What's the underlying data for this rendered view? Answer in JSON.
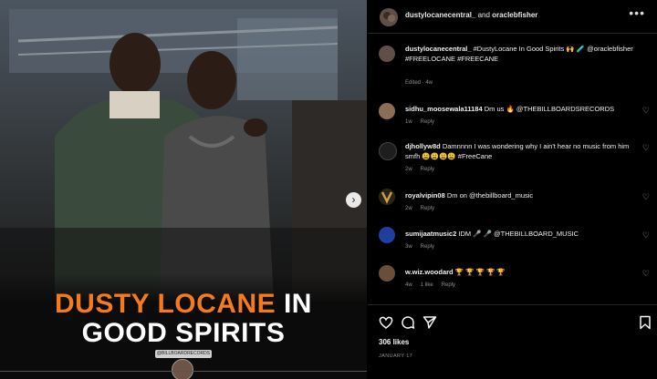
{
  "post": {
    "headline_line1_orange": "DUSTY LOCANE",
    "headline_line1_white": " IN",
    "headline_line2": "GOOD SPIRITS",
    "credit_text": "@BILLBOARDRECORDS"
  },
  "header": {
    "user1": "dustylocanecentral_",
    "connector": " and ",
    "user2": "oraclebfisher",
    "more": "•••"
  },
  "caption": {
    "username": "dustylocanecentral_",
    "text": " #DustyLocane In Good Spirits 🙌 🧪 @oraclebfisher #FREELOCANE #FREECANE",
    "meta": "Edited · 4w"
  },
  "comments": [
    {
      "username": "sidhu_moosewala11184",
      "text": " Dm us 🔥 @THEBILLBOARDSRECORDS",
      "age": "1w",
      "reply": "Reply",
      "likes": ""
    },
    {
      "username": "djhollyw8d",
      "text": " Damnnnn I was wondering why I ain't hear no music from him smfh 😩😩😩😩 #FreeCane",
      "age": "2w",
      "reply": "Reply",
      "likes": ""
    },
    {
      "username": "royalvipin08",
      "text": " Dm on @thebillboard_music",
      "age": "2w",
      "reply": "Reply",
      "likes": ""
    },
    {
      "username": "sumijaatmusic2",
      "text": " IDM 🎤 🎤 @THEBILLBOARD_MUSIC",
      "age": "3w",
      "reply": "Reply",
      "likes": ""
    },
    {
      "username": "w.wiz.woodard",
      "text": " 🏆 🏆 🏆 🏆 🏆",
      "age": "4w",
      "reply": "Reply",
      "likes": "1 like"
    }
  ],
  "likes": "306 likes",
  "date": "JANUARY 17",
  "icons": [
    "heart-icon",
    "comment-icon",
    "share-icon",
    "bookmark-icon",
    "next-arrow-icon",
    "more-icon"
  ],
  "colors": {
    "accent_orange": "#f47a1f",
    "background": "#000000",
    "muted": "#8e8e8e"
  }
}
